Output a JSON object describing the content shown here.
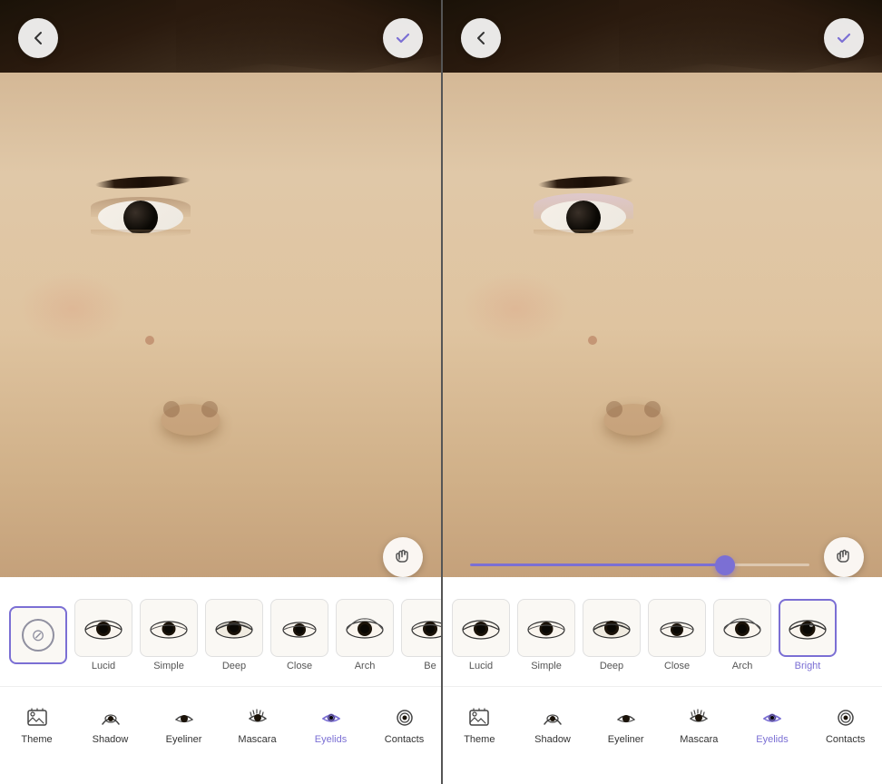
{
  "panels": [
    {
      "id": "left",
      "backBtn": "←",
      "checkBtn": "✓",
      "sliderVisible": false,
      "sliderValue": 0,
      "selectedStyle": "none",
      "styles": [
        {
          "id": "none",
          "label": "",
          "icon": "none"
        },
        {
          "id": "lucid",
          "label": "Lucid",
          "icon": "eye"
        },
        {
          "id": "simple",
          "label": "Simple",
          "icon": "eye"
        },
        {
          "id": "deep",
          "label": "Deep",
          "icon": "eye"
        },
        {
          "id": "close",
          "label": "Close",
          "icon": "eye"
        },
        {
          "id": "arch",
          "label": "Arch",
          "icon": "eye"
        },
        {
          "id": "be",
          "label": "Be",
          "icon": "eye"
        }
      ],
      "navItems": [
        {
          "id": "theme",
          "label": "Theme",
          "icon": "theme",
          "active": false
        },
        {
          "id": "shadow",
          "label": "Shadow",
          "icon": "shadow",
          "active": false
        },
        {
          "id": "eyeliner",
          "label": "Eyeliner",
          "icon": "eyeliner",
          "active": false
        },
        {
          "id": "mascara",
          "label": "Mascara",
          "icon": "mascara",
          "active": false
        },
        {
          "id": "eyelids",
          "label": "Eyelids",
          "icon": "eyelids",
          "active": true
        },
        {
          "id": "contacts",
          "label": "Contacts",
          "icon": "contacts",
          "active": false
        }
      ]
    },
    {
      "id": "right",
      "backBtn": "←",
      "checkBtn": "✓",
      "sliderVisible": true,
      "sliderValue": 75,
      "selectedStyle": "bright",
      "styles": [
        {
          "id": "lucid",
          "label": "Lucid",
          "icon": "eye"
        },
        {
          "id": "simple",
          "label": "Simple",
          "icon": "eye"
        },
        {
          "id": "deep",
          "label": "Deep",
          "icon": "eye"
        },
        {
          "id": "close",
          "label": "Close",
          "icon": "eye"
        },
        {
          "id": "arch",
          "label": "Arch",
          "icon": "eye"
        },
        {
          "id": "bright",
          "label": "Bright",
          "icon": "eye"
        }
      ],
      "navItems": [
        {
          "id": "theme",
          "label": "Theme",
          "icon": "theme",
          "active": false
        },
        {
          "id": "shadow",
          "label": "Shadow",
          "icon": "shadow",
          "active": false
        },
        {
          "id": "eyeliner",
          "label": "Eyeliner",
          "icon": "eyeliner",
          "active": false
        },
        {
          "id": "mascara",
          "label": "Mascara",
          "icon": "mascara",
          "active": false
        },
        {
          "id": "eyelids",
          "label": "Eyelids",
          "icon": "eyelids",
          "active": true
        },
        {
          "id": "contacts",
          "label": "Contacts",
          "icon": "contacts",
          "active": false
        }
      ]
    }
  ]
}
